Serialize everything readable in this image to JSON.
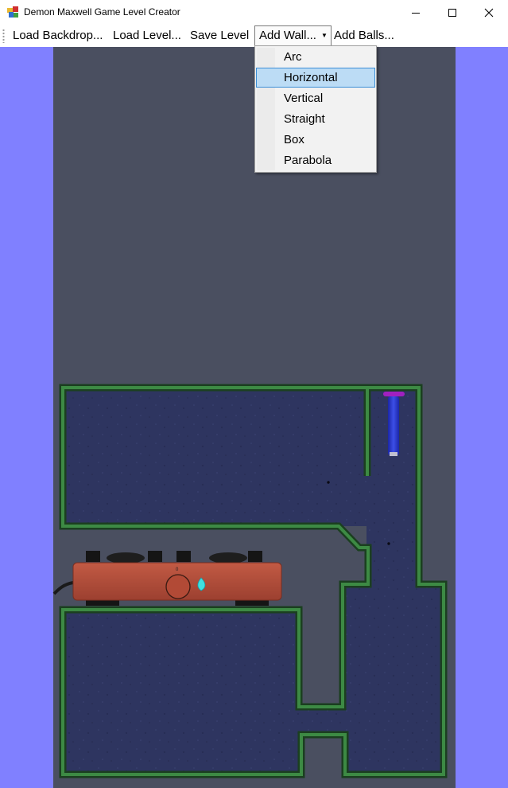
{
  "window": {
    "title": "Demon Maxwell Game Level Creator",
    "controls": [
      "minimize",
      "maximize",
      "close"
    ]
  },
  "menubar": {
    "items": [
      {
        "label": "Load Backdrop..."
      },
      {
        "label": "Load Level..."
      },
      {
        "label": "Save Level"
      },
      {
        "label": "Add Wall..."
      },
      {
        "label": "Add Balls..."
      }
    ]
  },
  "add_wall_menu": {
    "items": [
      "Arc",
      "Horizontal",
      "Vertical",
      "Straight",
      "Box",
      "Parabola"
    ],
    "highlighted": "Horizontal"
  },
  "colors": {
    "canvas_background": "#8080ff",
    "backdrop": "#4a4f60",
    "wall": "#1e4e24",
    "floor": "#2e3560",
    "stove": "#b14c38",
    "piston": "#2233cc",
    "flame": "#40e0e0",
    "menu_highlight": "#bcdcf5"
  },
  "icons": [
    "app-icon",
    "minimize-icon",
    "maximize-icon",
    "close-icon",
    "dropdown-caret-icon",
    "flame-icon",
    "knob-icon"
  ]
}
